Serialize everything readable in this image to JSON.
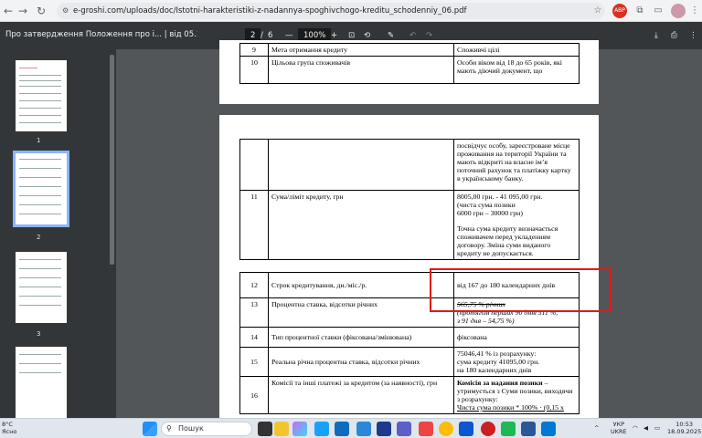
{
  "browser": {
    "url": "e-groshi.com/uploads/doc/Istotni-harakteristiki-z-nadannya-spoghivchogo-kreditu_schodenniy_06.pdf"
  },
  "pdf": {
    "title": "Про затвердження Положення про і... | від 05.10.2021 № 100",
    "page_current": "2",
    "page_sep": "/",
    "page_total": "6",
    "zoom": "100%",
    "minus": "—",
    "plus": "+"
  },
  "thumbs": [
    "1",
    "2",
    "3"
  ],
  "table_top": [
    {
      "n": "9",
      "name": "Мета отримання кредиту",
      "val": "Споживчі цілі"
    },
    {
      "n": "10",
      "name": "Цільова група споживачів",
      "val": "Особи віком від 18 до 65 років, які мають діючий документ, що"
    }
  ],
  "row_cont": "посвідчує особу, зареєстроване місце проживання на території України та мають відкриті на власне ім’я поточний рахунок та платіжку картку в українському банку.",
  "row11": {
    "n": "11",
    "name": "Сума/ліміт кредиту, грн",
    "val1": "8005,00 грн. - 41 095,00 грн.",
    "val2": "(чиста сума позики",
    "val3": "6000 грн – 30000 грн)",
    "val4": "Точна сума кредиту визначається споживачем перед укладенням договору. Зміна суми виданого кредиту не допускається."
  },
  "row12": {
    "n": "12",
    "name": "Строк кредитування, дн./міс./р.",
    "val": "від 167 до 180 календарних днів"
  },
  "row13": {
    "n": "13",
    "name": "Процентна ставка, відсотки річних",
    "val1": "565,75 % річних",
    "val2": "(протягом перших 90 днів 511 %,",
    "val3": "з 91 дня – 54,75 %)"
  },
  "row14": {
    "n": "14",
    "name": "Тип процентної ставки (фіксована/змінювана)",
    "val": "фіксована"
  },
  "row15": {
    "n": "15",
    "name": "Реальна річна процентна ставка, відсотки річних",
    "val1": "75046,41 % із розрахунку:",
    "val2": "сума кредиту  41095,00 грн.",
    "val3": "на 180 календарних днів"
  },
  "row16": {
    "n": "16",
    "name": "Комісії та інші платежі за кредитом (за наявності), грн",
    "val_b": "Комісія за надання позики",
    "val1": " – утримується з Суми позики, виходячи з розрахунку:",
    "val2": "Чиста сума позики * 100% · (0,15 х"
  },
  "taskbar": {
    "search": "Пошук",
    "weather_temp": "8°C",
    "weather_desc": "Ясно",
    "lang1": "УКР",
    "lang2": "UKRE",
    "time": "10:53",
    "date": "18.09.2025"
  },
  "colors": {
    "highlight": "#e01a1a",
    "toolbar": "#323639"
  }
}
